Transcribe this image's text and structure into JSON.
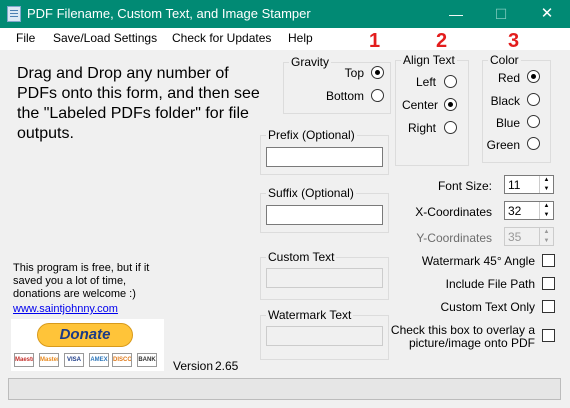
{
  "window": {
    "title": "PDF Filename, Custom Text, and Image Stamper",
    "minimize": "—",
    "maximize": "☐",
    "close": "✕"
  },
  "menu": [
    "File",
    "Save/Load Settings",
    "Check for Updates",
    "Help"
  ],
  "numbers": [
    "1",
    "2",
    "3"
  ],
  "instructions": "Drag and Drop any number of PDFs onto this form, and then see the \"Labeled PDFs folder\" for file outputs.",
  "free_text": "This program is free, but if it saved you a lot of time, donations are welcome :)",
  "link": "www.saintjohnny.com",
  "donate": {
    "label": "Donate",
    "cards": [
      {
        "name": "Maestro",
        "color": "#c4302b"
      },
      {
        "name": "MasterCard",
        "color": "#e8891c"
      },
      {
        "name": "VISA",
        "color": "#1a3a87"
      },
      {
        "name": "AMEX",
        "color": "#2e77bb"
      },
      {
        "name": "DISCOVER",
        "color": "#e07b1c"
      },
      {
        "name": "BANK",
        "color": "#333333"
      }
    ]
  },
  "version": {
    "label": "Version",
    "value": "2.65"
  },
  "gravity": {
    "title": "Gravity",
    "options": [
      {
        "label": "Top",
        "selected": true
      },
      {
        "label": "Bottom",
        "selected": false
      }
    ]
  },
  "align": {
    "title": "Align Text",
    "options": [
      {
        "label": "Left",
        "selected": false
      },
      {
        "label": "Center",
        "selected": true
      },
      {
        "label": "Right",
        "selected": false
      }
    ]
  },
  "color": {
    "title": "Color",
    "options": [
      {
        "label": "Red",
        "selected": true
      },
      {
        "label": "Black",
        "selected": false
      },
      {
        "label": "Blue",
        "selected": false
      },
      {
        "label": "Green",
        "selected": false
      }
    ]
  },
  "fields": {
    "prefix": {
      "label": "Prefix (Optional)",
      "value": ""
    },
    "suffix": {
      "label": "Suffix (Optional)",
      "value": ""
    },
    "custom_text": {
      "label": "Custom Text",
      "value": ""
    },
    "watermark_text": {
      "label": "Watermark Text",
      "value": ""
    }
  },
  "font_size": {
    "label": "Font Size:",
    "value": "11"
  },
  "x_coord": {
    "label": "X-Coordinates",
    "value": "32"
  },
  "y_coord": {
    "label": "Y-Coordinates",
    "value": "35"
  },
  "checks": [
    {
      "label": "Watermark 45° Angle",
      "checked": false
    },
    {
      "label": "Include File Path",
      "checked": false
    },
    {
      "label": "Custom Text Only",
      "checked": false
    }
  ],
  "overlay_check": {
    "label_line1": "Check this box to overlay a",
    "label_line2": "picture/image onto PDF",
    "checked": false
  },
  "colors": {
    "titlebar": "#018a74",
    "accent_numbers": "#e31d1d",
    "link": "#0000ee"
  }
}
